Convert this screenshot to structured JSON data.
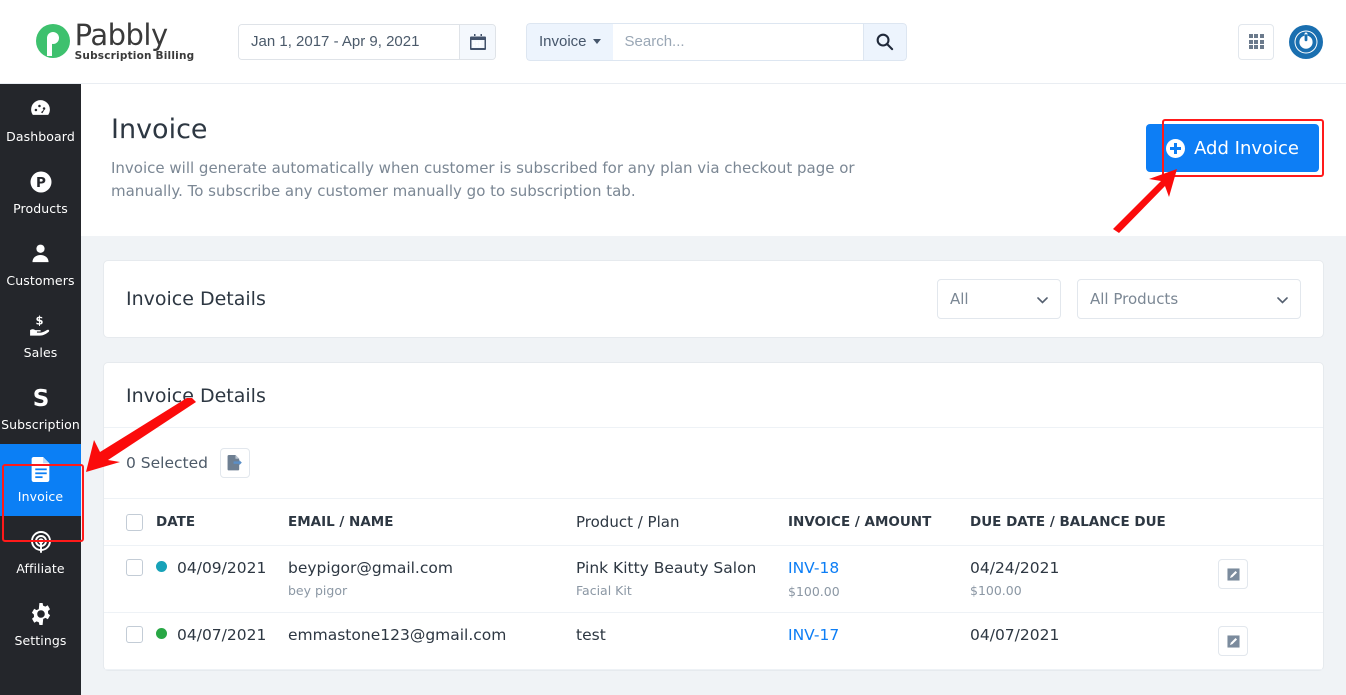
{
  "brand": {
    "name": "Pabbly",
    "tagline": "Subscription Billing",
    "green": "#3ec16e",
    "blue": "#0d7ef5"
  },
  "topbar": {
    "date_range_value": "Jan 1, 2017 - Apr 9, 2021",
    "calendar_icon": "calendar-icon",
    "search_scope": "Invoice",
    "search_placeholder": "Search...",
    "search_value": "",
    "search_icon": "search-icon",
    "apps_icon": "grid-apps-icon",
    "account_icon": "user-account-icon"
  },
  "sidebar": {
    "items": [
      {
        "label": "Dashboard",
        "icon": "speedometer-icon",
        "active": false
      },
      {
        "label": "Products",
        "icon": "product-p-icon",
        "active": false
      },
      {
        "label": "Customers",
        "icon": "user-icon",
        "active": false
      },
      {
        "label": "Sales",
        "icon": "hand-dollar-icon",
        "active": false
      },
      {
        "label": "Subscription",
        "icon": "stripe-s-icon",
        "active": false
      },
      {
        "label": "Invoice",
        "icon": "document-icon",
        "active": true
      },
      {
        "label": "Affiliate",
        "icon": "broadcast-icon",
        "active": false
      },
      {
        "label": "Settings",
        "icon": "gear-icon",
        "active": false
      }
    ]
  },
  "page": {
    "title": "Invoice",
    "description": "Invoice will generate automatically when customer is subscribed for any plan via checkout page or manually. To subscribe any customer manually go to subscription tab.",
    "add_button_label": "Add Invoice",
    "add_button_icon": "plus-circle-icon"
  },
  "filter_card": {
    "title": "Invoice Details",
    "status_select": {
      "value": "All",
      "icon": "chevron-down-icon"
    },
    "product_select": {
      "value": "All Products",
      "icon": "chevron-down-icon"
    }
  },
  "table_card": {
    "title": "Invoice Details",
    "selected_label": "0 Selected",
    "export_icon": "export-file-icon",
    "columns": [
      {
        "label": "",
        "key": "check"
      },
      {
        "label": "DATE",
        "key": "date"
      },
      {
        "label": "EMAIL / NAME",
        "key": "email"
      },
      {
        "label": "Product / Plan",
        "key": "product"
      },
      {
        "label": "INVOICE / AMOUNT",
        "key": "invoice"
      },
      {
        "label": "DUE DATE / BALANCE DUE",
        "key": "due"
      }
    ],
    "rows": [
      {
        "status_color": "#17a2b8",
        "date": "04/09/2021",
        "email": "beypigor@gmail.com",
        "name": "bey pigor",
        "product": "Pink Kitty Beauty Salon",
        "plan": "Facial Kit",
        "invoice": "INV-18",
        "amount": "$100.00",
        "due_date": "04/24/2021",
        "balance_due": "$100.00",
        "action_icon": "edit-icon"
      },
      {
        "status_color": "#28a745",
        "date": "04/07/2021",
        "email": "emmastone123@gmail.com",
        "name": "",
        "product": "test",
        "plan": "",
        "invoice": "INV-17",
        "amount": "",
        "due_date": "04/07/2021",
        "balance_due": "",
        "action_icon": "edit-icon"
      }
    ]
  },
  "annotations": {
    "highlight_color": "#ff1a1a",
    "arrow_to_add_invoice": "red-arrow-icon",
    "arrow_to_invoice_nav": "red-arrow-icon"
  }
}
